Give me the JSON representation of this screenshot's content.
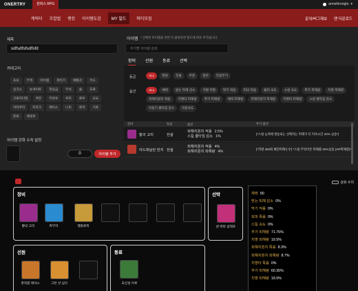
{
  "header": {
    "logo": "ONERTRY",
    "logo_tab": "원피스 RPG",
    "user": "armshirongto",
    "nav": [
      "캐릭터",
      "조합법",
      "랭킹",
      "아이템도감",
      "MY 빌드",
      "파티모집"
    ],
    "nav_active": "MY 빌드",
    "right_links": [
      "문의/버그제보",
      "맨 다운로드"
    ]
  },
  "editor": {
    "title_label": "제목",
    "title_value": "sdfsdfsfsdfsfd",
    "category_label": "카테고리",
    "categories": [
      "초보",
      "무역",
      "아이템",
      "파티기",
      "배틀코",
      "키드",
      "상크스",
      "뉴게이트",
      "현상금",
      "무쇠",
      "술",
      "조로",
      "크로커다일",
      "쿠잔",
      "키자루",
      "루피",
      "로우",
      "오오",
      "카타쿠리",
      "미호크",
      "에이스",
      "니미",
      "로저",
      "거프",
      "분류",
      "에네루"
    ],
    "enhance_label": "아이템 강화 수치 설정",
    "enhance_value": "0",
    "add_button": "아이템 추가",
    "item_label": "아이템",
    "item_hint": "* 선택된 아이템을 한번 더 클릭하면 빌드에 바로 추가됩니다.",
    "search_placeholder": "추가할 아이템 검색",
    "type_tabs": [
      "장비",
      "선원",
      "동료",
      "선박"
    ],
    "grade_label": "등급",
    "grades": [
      "ALL",
      "영원",
      "전설",
      "주문",
      "일반",
      "전용무기"
    ],
    "option_label": "옵션",
    "options": [
      "ALL",
      "체력",
      "받는 피해 감소",
      "치명 저항",
      "악기 적용",
      "피의 적용",
      "물리 속도",
      "스킬 속도",
      "추가 피해량",
      "치명 피해량",
      "피해지원치 적용",
      "치명타 피해량",
      "추가 피해량",
      "체력 피해량",
      "피해지원치 피해량",
      "치명타 피해량",
      "스킬 쿨타임 감소",
      "이동기 쿨타임 감소",
      "이동속도"
    ],
    "count_label": "총 167개",
    "table_headers": [
      "장비",
      "등급",
      "옵션",
      "추가 옵션"
    ],
    "rows": [
      {
        "name": "황의 고리",
        "grade": "전설",
        "opt1": "피해지원치 적용",
        "val1": "2.5%",
        "opt2": "스킬 쿨타임 감소",
        "val2": "1%",
        "extra": "[*스킬 능력에 발동되는 선택하는 피해가 더 지속시간 20% 상승*]",
        "icon_color": "#9a2c8e"
      },
      {
        "name": "아드레날린 반지",
        "grade": "전설",
        "opt1": "피해지원치 적용",
        "val1": "4%",
        "opt2": "피해지원치 피해량",
        "val2": "4%",
        "extra": "[*치명 300회 패턴피해*] *[*] *스킬 무엇이든 피해를 20%상승 (HP피해량)*",
        "icon_color": "#b83a2e"
      }
    ]
  },
  "build": {
    "toggle_label": "강화 수치",
    "equipment_title": "장비",
    "equipment": [
      {
        "label": "황의 고리",
        "color": "#9a2c8e"
      },
      {
        "label": "파부하",
        "color": "#2a8bd0"
      },
      {
        "label": "엘칼로피",
        "color": "#c79a3a"
      }
    ],
    "ship_title": "선박",
    "ship": {
      "label": "퀸 마마 샹테호",
      "color": "#c2307a"
    },
    "crew_title": "선원",
    "crew": [
      {
        "label": "경하였 에이스",
        "color": "#c8762a"
      },
      {
        "label": "그런 샷 심다",
        "color": "#d89030"
      }
    ],
    "mate_title": "동료",
    "mate": {
      "label": "초신성 이루",
      "color": "#3c7a3a"
    },
    "stats": [
      {
        "name": "체력",
        "value": "90"
      },
      {
        "name": "받는 피해 감소",
        "value": "0%"
      },
      {
        "name": "막기 적용",
        "value": "0%"
      },
      {
        "name": "회피 확률",
        "value": "0%"
      },
      {
        "name": "스킬 속도",
        "value": "0%"
      },
      {
        "name": "추가 피해량",
        "value": "71.75%"
      },
      {
        "name": "치명 피해량",
        "value": "19.5%"
      },
      {
        "name": "피해지원치 확률",
        "value": "8.3%"
      },
      {
        "name": "피해지원치 피해량",
        "value": "8.7%"
      },
      {
        "name": "치명타 확률",
        "value": "0%"
      },
      {
        "name": "추가 피해량",
        "value": "60.35%"
      },
      {
        "name": "치명 피해량",
        "value": "19.5%"
      }
    ]
  }
}
